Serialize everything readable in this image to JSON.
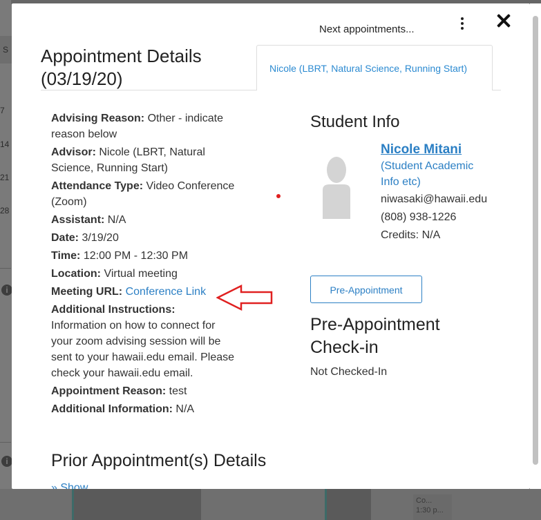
{
  "background": {
    "col_s": "S",
    "days": [
      "7",
      "14",
      "21",
      "28"
    ],
    "info_icon": "info-icon",
    "calendar_item_lines": [
      "Co...",
      "1:30 p..."
    ]
  },
  "modal": {
    "next_appointments": "Next appointments...",
    "title_line1": "Appointment Details",
    "title_line2": "(03/19/20)",
    "tab_label": "Nicole (LBRT, Natural Science, Running Start)",
    "kebab_icon": "more-vertical-icon",
    "close_icon": "close-icon"
  },
  "details": {
    "advising_reason_label": "Advising Reason:",
    "advising_reason_value": " Other - indicate reason below",
    "advisor_label": "Advisor:",
    "advisor_value": " Nicole (LBRT, Natural Science, Running Start)",
    "attendance_label": "Attendance Type:",
    "attendance_value": " Video Conference (Zoom)",
    "assistant_label": "Assistant:",
    "assistant_value": " N/A",
    "date_label": "Date:",
    "date_value": " 3/19/20",
    "time_label": "Time:",
    "time_value": " 12:00 PM - 12:30 PM",
    "location_label": "Location:",
    "location_value": " Virtual meeting",
    "meeting_url_label": "Meeting URL:",
    "meeting_url_link": "Conference Link",
    "additional_instructions_label": "Additional Instructions:",
    "additional_instructions_value": "Information on how to connect for your zoom advising session will be sent to your hawaii.edu email. Please check your hawaii.edu email.",
    "appointment_reason_label": "Appointment Reason:",
    "appointment_reason_value": " test",
    "additional_info_label": "Additional Information:",
    "additional_info_value": " N/A"
  },
  "student": {
    "section_title": "Student Info",
    "name": "Nicole Mitani",
    "subtitle": "(Student Academic Info etc)",
    "email": "niwasaki@hawaii.edu",
    "phone": "(808) 938-1226",
    "credits": "Credits: N/A",
    "avatar_icon": "user-avatar-icon"
  },
  "pre_appointment": {
    "button_label": "Pre-Appointment",
    "title": "Pre-Appointment Check-in",
    "status": "Not Checked-In"
  },
  "prior": {
    "title": "Prior Appointment(s) Details",
    "show_label": "Show"
  },
  "colors": {
    "link": "#2b7fc4",
    "annotation_red": "#e02020"
  }
}
